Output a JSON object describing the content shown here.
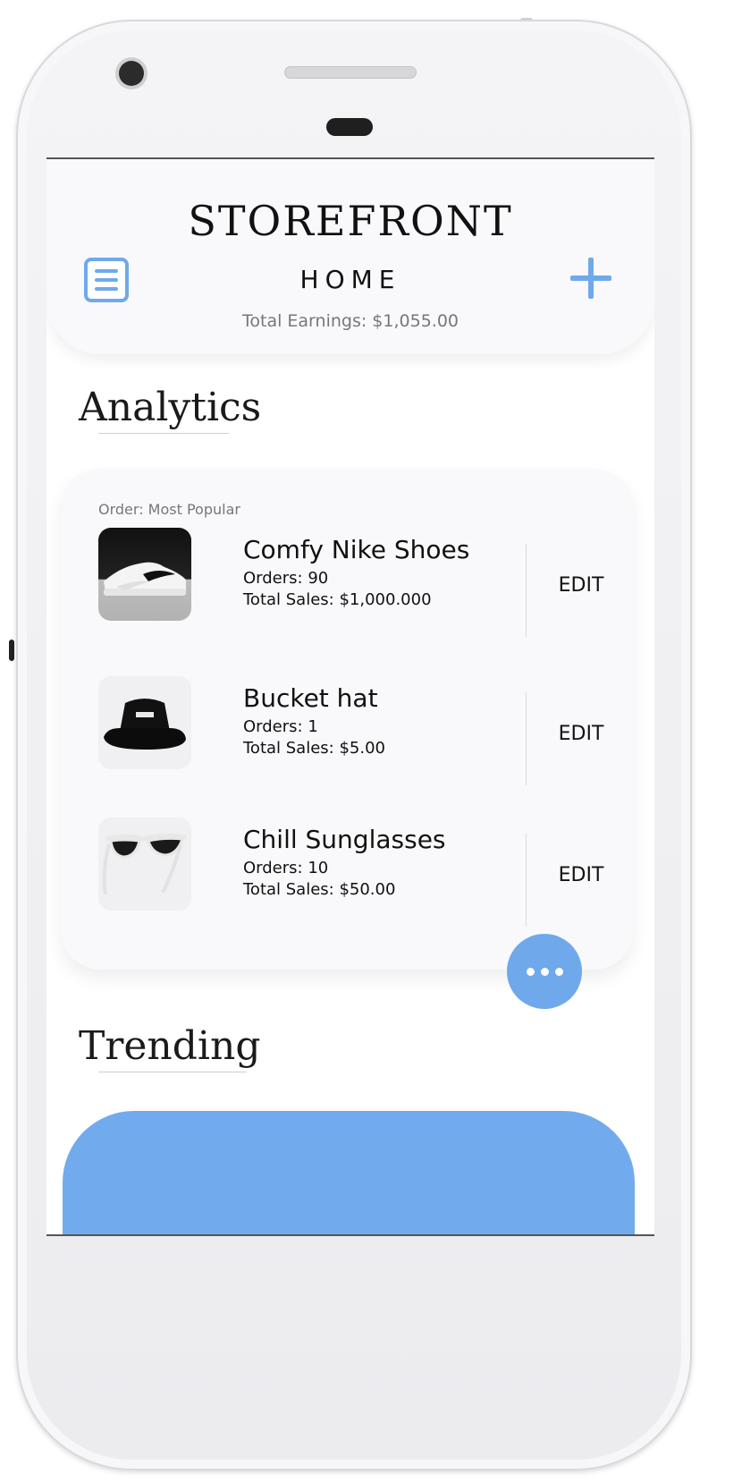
{
  "header": {
    "brand": "STOREFRONT",
    "title": "HOME",
    "earnings": "Total Earnings: $1,055.00"
  },
  "analytics": {
    "title": "Analytics",
    "order_label": "Order: Most Popular",
    "items": [
      {
        "name": "Comfy Nike Shoes",
        "orders": "Orders: 90",
        "sales": "Total Sales: $1,000.000",
        "edit": "EDIT",
        "icon": "sneaker-image"
      },
      {
        "name": "Bucket hat",
        "orders": "Orders: 1",
        "sales": "Total Sales: $5.00",
        "edit": "EDIT",
        "icon": "bucket-hat-image"
      },
      {
        "name": "Chill Sunglasses",
        "orders": "Orders: 10",
        "sales": "Total Sales: $50.00",
        "edit": "EDIT",
        "icon": "sunglasses-image"
      }
    ]
  },
  "trending": {
    "title": "Trending"
  },
  "colors": {
    "accent": "#6fa9ec",
    "trending_card": "#72abed"
  }
}
